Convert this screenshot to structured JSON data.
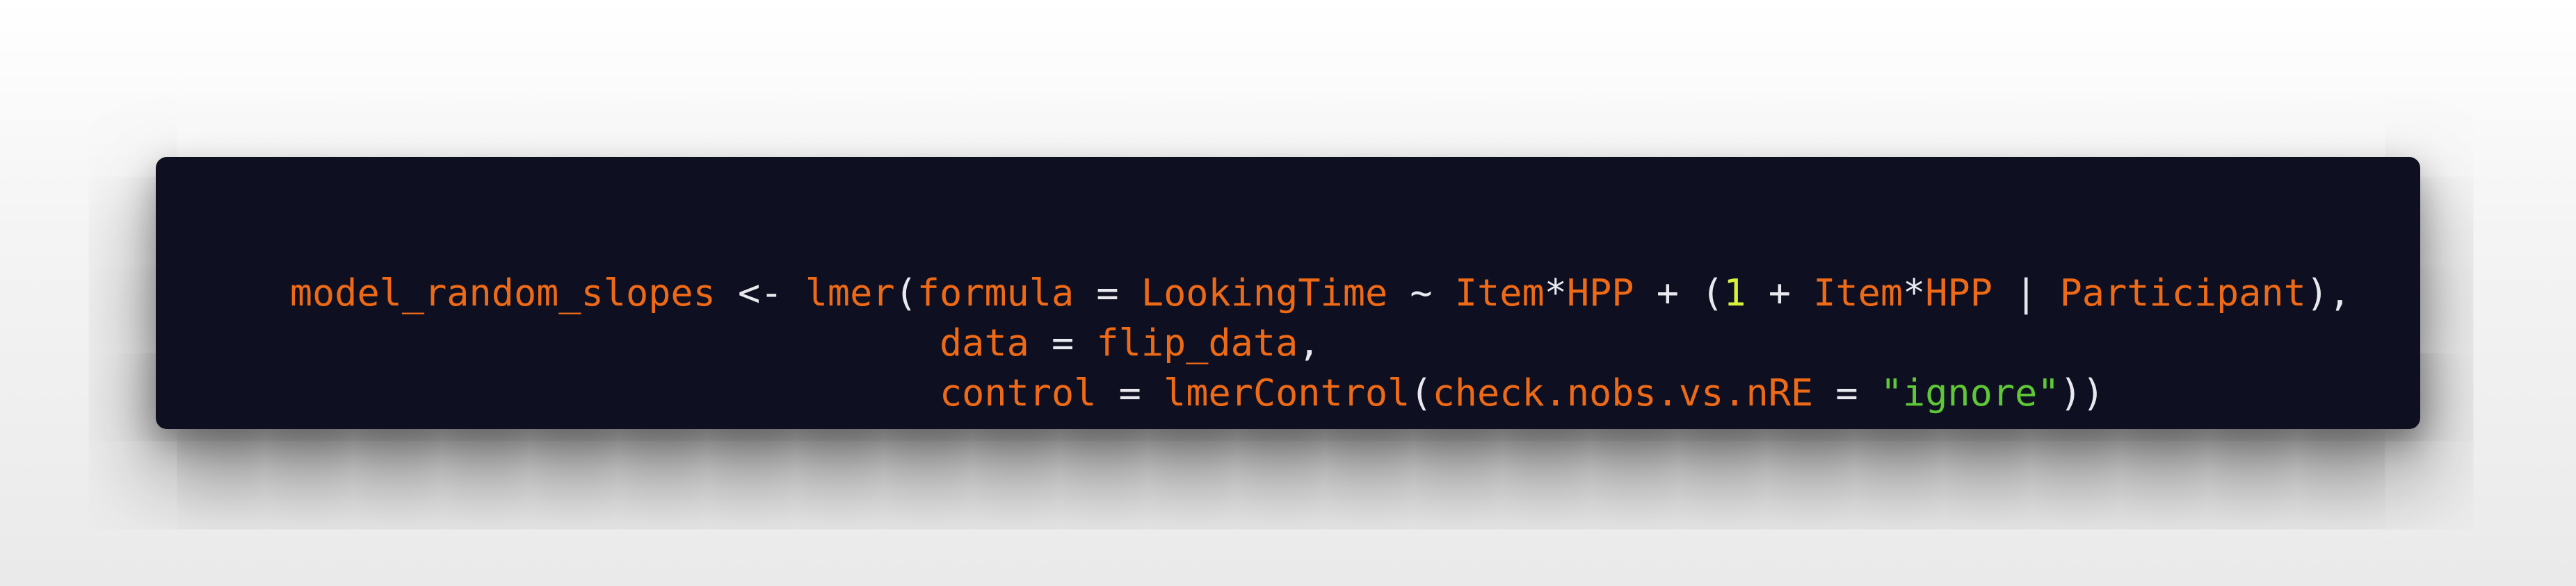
{
  "code": {
    "language": "R",
    "lines": [
      [
        {
          "t": "model_random_slopes",
          "k": "id"
        },
        {
          "t": " <- ",
          "k": "op"
        },
        {
          "t": "lmer",
          "k": "id"
        },
        {
          "t": "(",
          "k": "op"
        },
        {
          "t": "formula",
          "k": "id"
        },
        {
          "t": " = ",
          "k": "op"
        },
        {
          "t": "LookingTime",
          "k": "id"
        },
        {
          "t": " ~ ",
          "k": "op"
        },
        {
          "t": "Item",
          "k": "id"
        },
        {
          "t": "*",
          "k": "op"
        },
        {
          "t": "HPP",
          "k": "id"
        },
        {
          "t": " + (",
          "k": "op"
        },
        {
          "t": "1",
          "k": "num"
        },
        {
          "t": " + ",
          "k": "op"
        },
        {
          "t": "Item",
          "k": "id"
        },
        {
          "t": "*",
          "k": "op"
        },
        {
          "t": "HPP",
          "k": "id"
        },
        {
          "t": " | ",
          "k": "op"
        },
        {
          "t": "Participant",
          "k": "id"
        },
        {
          "t": "),",
          "k": "op"
        }
      ],
      [
        {
          "t": "                             ",
          "k": "op"
        },
        {
          "t": "data",
          "k": "id"
        },
        {
          "t": " = ",
          "k": "op"
        },
        {
          "t": "flip_data",
          "k": "id"
        },
        {
          "t": ",",
          "k": "op"
        }
      ],
      [
        {
          "t": "                             ",
          "k": "op"
        },
        {
          "t": "control",
          "k": "id"
        },
        {
          "t": " = ",
          "k": "op"
        },
        {
          "t": "lmerControl",
          "k": "id"
        },
        {
          "t": "(",
          "k": "op"
        },
        {
          "t": "check.nobs.vs.nRE",
          "k": "id"
        },
        {
          "t": " = ",
          "k": "op"
        },
        {
          "t": "\"ignore\"",
          "k": "str"
        },
        {
          "t": "))",
          "k": "op"
        }
      ]
    ]
  },
  "colors": {
    "background": "#0e1021",
    "identifier": "#ee6a16",
    "operator": "#e8e8ee",
    "number": "#d8f23a",
    "string": "#5fc836"
  }
}
